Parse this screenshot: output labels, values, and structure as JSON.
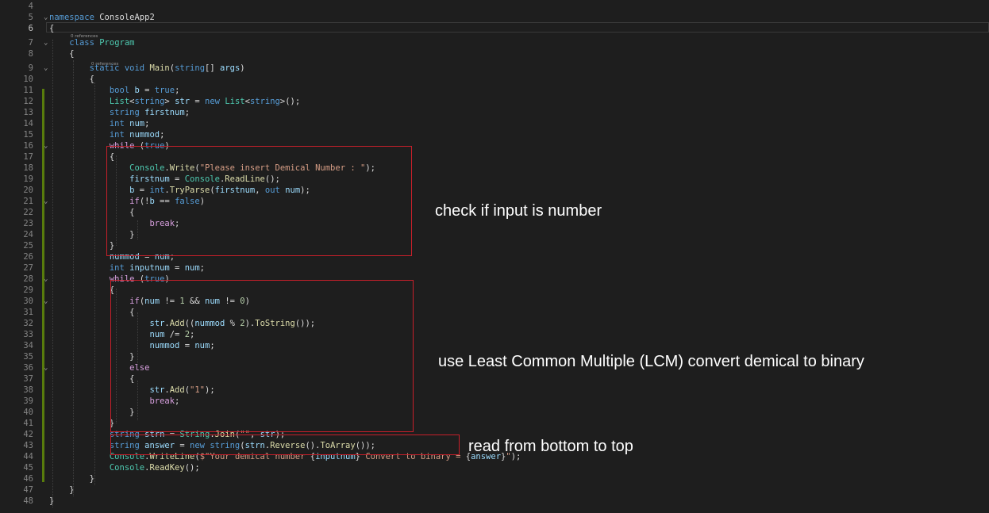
{
  "editor": {
    "active_line": "6",
    "references_label": "0 references",
    "lines": [
      {
        "n": "4",
        "t": ""
      },
      {
        "n": "5",
        "t": "namespace ConsoleApp2"
      },
      {
        "n": "6",
        "t": "{"
      },
      {
        "n": "7",
        "t": "    class Program"
      },
      {
        "n": "8",
        "t": "    {"
      },
      {
        "n": "9",
        "t": "        static void Main(string[] args)"
      },
      {
        "n": "10",
        "t": "        {"
      },
      {
        "n": "11",
        "t": "            bool b = true;"
      },
      {
        "n": "12",
        "t": "            List<string> str = new List<string>();"
      },
      {
        "n": "13",
        "t": "            string firstnum;"
      },
      {
        "n": "14",
        "t": "            int num;"
      },
      {
        "n": "15",
        "t": "            int nummod;"
      },
      {
        "n": "16",
        "t": "            while (true)"
      },
      {
        "n": "17",
        "t": "            {"
      },
      {
        "n": "18",
        "t": "                Console.Write(\"Please insert Demical Number : \");"
      },
      {
        "n": "19",
        "t": "                firstnum = Console.ReadLine();"
      },
      {
        "n": "20",
        "t": "                b = int.TryParse(firstnum, out num);"
      },
      {
        "n": "21",
        "t": "                if(!b == false)"
      },
      {
        "n": "22",
        "t": "                {"
      },
      {
        "n": "23",
        "t": "                    break;"
      },
      {
        "n": "24",
        "t": "                }"
      },
      {
        "n": "25",
        "t": "            }"
      },
      {
        "n": "26",
        "t": "            nummod = num;"
      },
      {
        "n": "27",
        "t": "            int inputnum = num;"
      },
      {
        "n": "28",
        "t": "            while (true)"
      },
      {
        "n": "29",
        "t": "            {"
      },
      {
        "n": "30",
        "t": "                if(num != 1 && num != 0)"
      },
      {
        "n": "31",
        "t": "                {"
      },
      {
        "n": "32",
        "t": "                    str.Add((nummod % 2).ToString());"
      },
      {
        "n": "33",
        "t": "                    num /= 2;"
      },
      {
        "n": "34",
        "t": "                    nummod = num;"
      },
      {
        "n": "35",
        "t": "                }"
      },
      {
        "n": "36",
        "t": "                else"
      },
      {
        "n": "37",
        "t": "                {"
      },
      {
        "n": "38",
        "t": "                    str.Add(\"1\");"
      },
      {
        "n": "39",
        "t": "                    break;"
      },
      {
        "n": "40",
        "t": "                }"
      },
      {
        "n": "41",
        "t": "            }"
      },
      {
        "n": "42",
        "t": "            string strn = String.Join(\"\", str);"
      },
      {
        "n": "43",
        "t": "            string answer = new string(strn.Reverse().ToArray());"
      },
      {
        "n": "44",
        "t": "            Console.WriteLine($\"Your demical number {inputnum} Convert to binary = {answer}\");"
      },
      {
        "n": "45",
        "t": "            Console.ReadKey();"
      },
      {
        "n": "46",
        "t": "        }"
      },
      {
        "n": "47",
        "t": "    }"
      },
      {
        "n": "48",
        "t": "}"
      }
    ]
  },
  "annotations": {
    "input_check": "check if input is number",
    "lcm_convert": "use Least Common Multiple (LCM) convert demical to binary",
    "read_order": "read from bottom to top"
  },
  "colors": {
    "background": "#1e1e1e",
    "keyword": "#569cd6",
    "control": "#d8a0df",
    "type": "#4ec9b0",
    "method": "#dcdcaa",
    "variable": "#9cdcfe",
    "string": "#d69d85",
    "number": "#b5cea8",
    "highlight_box": "#c8202a",
    "change_bar": "#587c0c"
  }
}
